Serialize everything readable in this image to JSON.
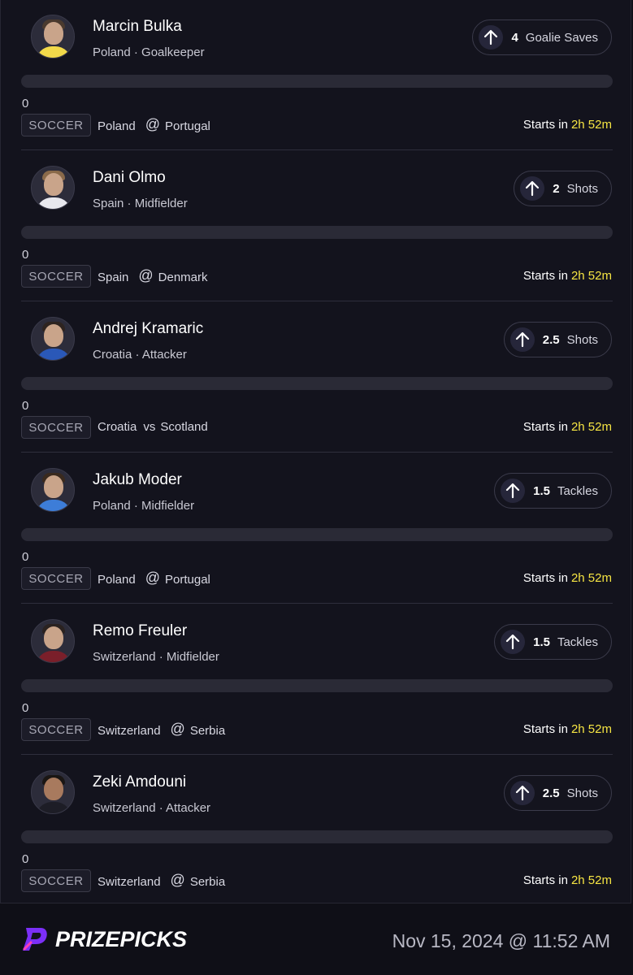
{
  "picks": [
    {
      "name": "Marcin Bulka",
      "subtitle": "Poland · Goalkeeper",
      "line": "4",
      "stat": "Goalie Saves",
      "progress": "0",
      "sport": "SOCCER",
      "team": "Poland",
      "connector": "@",
      "opponent": "Portugal",
      "starts_label": "Starts in",
      "starts_time": "2h 52m",
      "shirt_color": "#f2d94a"
    },
    {
      "name": "Dani Olmo",
      "subtitle": "Spain · Midfielder",
      "line": "2",
      "stat": "Shots",
      "progress": "0",
      "sport": "SOCCER",
      "team": "Spain",
      "connector": "@",
      "opponent": "Denmark",
      "starts_label": "Starts in",
      "starts_time": "2h 52m",
      "shirt_color": "#e8e8ee"
    },
    {
      "name": "Andrej Kramaric",
      "subtitle": "Croatia · Attacker",
      "line": "2.5",
      "stat": "Shots",
      "progress": "0",
      "sport": "SOCCER",
      "team": "Croatia",
      "connector": "vs",
      "opponent": "Scotland",
      "starts_label": "Starts in",
      "starts_time": "2h 52m",
      "shirt_color": "#2a58b8"
    },
    {
      "name": "Jakub Moder",
      "subtitle": "Poland · Midfielder",
      "line": "1.5",
      "stat": "Tackles",
      "progress": "0",
      "sport": "SOCCER",
      "team": "Poland",
      "connector": "@",
      "opponent": "Portugal",
      "starts_label": "Starts in",
      "starts_time": "2h 52m",
      "shirt_color": "#3d7dd8"
    },
    {
      "name": "Remo Freuler",
      "subtitle": "Switzerland · Midfielder",
      "line": "1.5",
      "stat": "Tackles",
      "progress": "0",
      "sport": "SOCCER",
      "team": "Switzerland",
      "connector": "@",
      "opponent": "Serbia",
      "starts_label": "Starts in",
      "starts_time": "2h 52m",
      "shirt_color": "#7a1f2a"
    },
    {
      "name": "Zeki Amdouni",
      "subtitle": "Switzerland · Attacker",
      "line": "2.5",
      "stat": "Shots",
      "progress": "0",
      "sport": "SOCCER",
      "team": "Switzerland",
      "connector": "@",
      "opponent": "Serbia",
      "starts_label": "Starts in",
      "starts_time": "2h 52m",
      "shirt_color": "#1d1d26"
    }
  ],
  "icons": {
    "pick_direction": "arrow-up-icon",
    "logo": "prizepicks-logo-icon"
  },
  "colors": {
    "accent_time": "#f6e543",
    "logo_purple": "#7b2ff7",
    "background": "#13131d"
  },
  "footer": {
    "brand": "PRIZEPICKS",
    "timestamp": "Nov 15, 2024 @ 11:52 AM"
  }
}
